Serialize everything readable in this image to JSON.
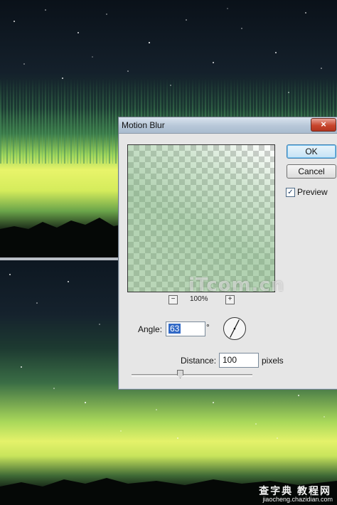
{
  "dialog": {
    "title": "Motion Blur",
    "close_label": "×",
    "ok_label": "OK",
    "cancel_label": "Cancel",
    "preview_label": "Preview",
    "preview_checked": true,
    "zoom": {
      "minus": "−",
      "plus": "+",
      "level": "100%"
    },
    "angle": {
      "label": "Angle:",
      "value": "63",
      "unit": "°"
    },
    "distance": {
      "label": "Distance:",
      "value": "100",
      "unit": "pixels",
      "level": 0.4
    }
  },
  "watermark": {
    "text": "iTcom.cn"
  },
  "site": {
    "title": "查字典 教程网",
    "url": "jiaocheng.chazidian.com"
  },
  "colors": {
    "aurora": "#e6f36a",
    "sky": "#0b1420",
    "dialog_bg": "#e6e6e6",
    "ok_accent": "#3c7fb1"
  }
}
